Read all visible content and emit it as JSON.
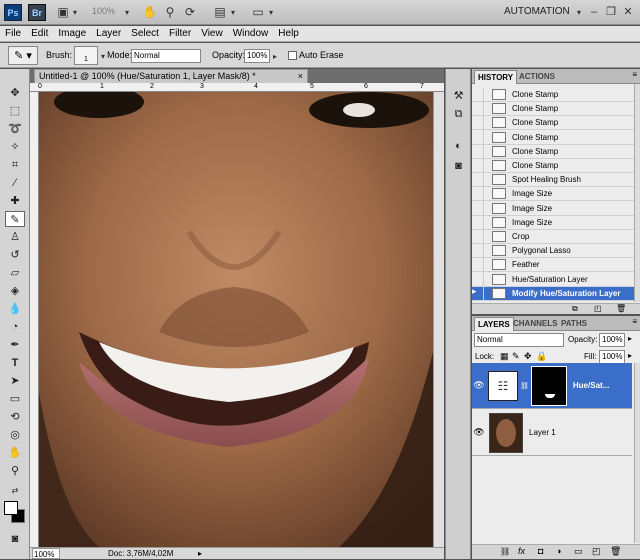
{
  "app": {
    "logo": "Ps",
    "bridge": "Br",
    "zoom": "100%",
    "workspace": "AUTOMATION"
  },
  "menu": [
    "File",
    "Edit",
    "Image",
    "Layer",
    "Select",
    "Filter",
    "View",
    "Window",
    "Help"
  ],
  "options": {
    "brush_label": "Brush:",
    "brush_size": "1",
    "mode_label": "Mode:",
    "mode_value": "Normal",
    "opacity_label": "Opacity:",
    "opacity_value": "100%",
    "auto_erase_label": "Auto Erase"
  },
  "document": {
    "tab_title": "Untitled-1 @ 100% (Hue/Saturation 1, Layer Mask/8) *",
    "tab_close": "×",
    "zoom": "100%",
    "doc_info": "Doc: 3,76M/4,02M",
    "ruler_ticks": [
      "0",
      "1",
      "2",
      "3",
      "4",
      "5",
      "6",
      "7"
    ]
  },
  "history": {
    "tabs": [
      "HISTORY",
      "ACTIONS"
    ],
    "items": [
      {
        "label": "Clone Stamp",
        "icon": "clone-stamp-icon"
      },
      {
        "label": "Clone Stamp",
        "icon": "clone-stamp-icon"
      },
      {
        "label": "Clone Stamp",
        "icon": "clone-stamp-icon"
      },
      {
        "label": "Clone Stamp",
        "icon": "clone-stamp-icon"
      },
      {
        "label": "Clone Stamp",
        "icon": "clone-stamp-icon"
      },
      {
        "label": "Clone Stamp",
        "icon": "clone-stamp-icon"
      },
      {
        "label": "Spot Healing Brush",
        "icon": "spot-healing-brush-icon"
      },
      {
        "label": "Image Size",
        "icon": "document-icon"
      },
      {
        "label": "Image Size",
        "icon": "document-icon"
      },
      {
        "label": "Image Size",
        "icon": "document-icon"
      },
      {
        "label": "Crop",
        "icon": "crop-icon"
      },
      {
        "label": "Polygonal Lasso",
        "icon": "polygonal-lasso-icon"
      },
      {
        "label": "Feather",
        "icon": "document-icon"
      },
      {
        "label": "Hue/Saturation Layer",
        "icon": "document-icon"
      },
      {
        "label": "Modify Hue/Saturation Layer",
        "icon": "document-icon",
        "active": true
      }
    ]
  },
  "layers": {
    "tabs": [
      "LAYERS",
      "CHANNELS",
      "PATHS"
    ],
    "blend_mode": "Normal",
    "opacity_label": "Opacity:",
    "opacity_value": "100%",
    "lock_label": "Lock:",
    "fill_label": "Fill:",
    "fill_value": "100%",
    "items": [
      {
        "name": "Hue/Sat...",
        "selected": true
      },
      {
        "name": "Layer 1",
        "selected": false
      }
    ],
    "bottom_icons": [
      "link-icon",
      "fx-icon",
      "mask-icon",
      "adjustment-icon",
      "group-icon",
      "new-layer-icon",
      "trash-icon"
    ]
  },
  "colors": {
    "selection": "#3a6ec8",
    "panel_bg": "#ececec",
    "chrome": "#d4d4d4"
  }
}
